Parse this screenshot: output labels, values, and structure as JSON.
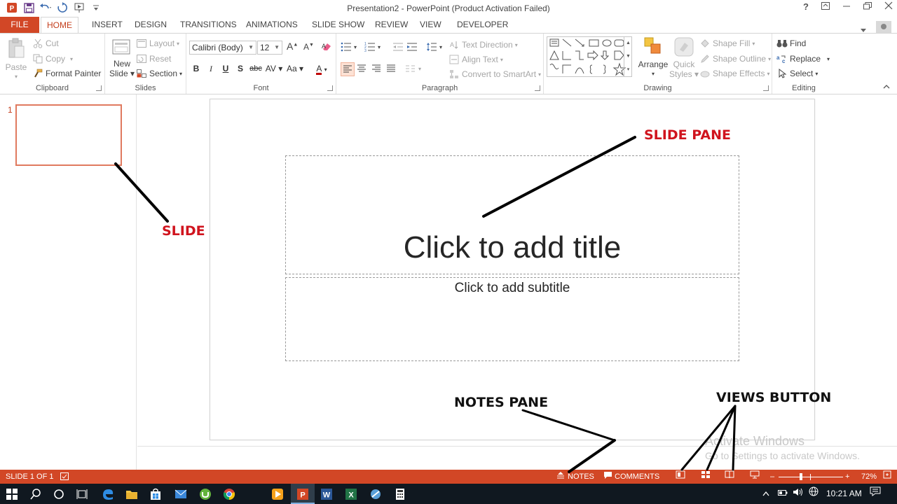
{
  "window": {
    "title": "Presentation2 - PowerPoint (Product Activation Failed)",
    "help": "?"
  },
  "tabs": [
    "FILE",
    "HOME",
    "INSERT",
    "DESIGN",
    "TRANSITIONS",
    "ANIMATIONS",
    "SLIDE SHOW",
    "REVIEW",
    "VIEW",
    "DEVELOPER"
  ],
  "ribbon": {
    "clipboard": {
      "label": "Clipboard",
      "paste": "Paste",
      "cut": "Cut",
      "copy": "Copy",
      "format_painter": "Format Painter"
    },
    "slides": {
      "label": "Slides",
      "new_slide_1": "New",
      "new_slide_2": "Slide",
      "layout": "Layout",
      "reset": "Reset",
      "section": "Section"
    },
    "font": {
      "label": "Font",
      "family": "Calibri (Body)",
      "size": "12"
    },
    "paragraph": {
      "label": "Paragraph",
      "text_direction": "Text Direction",
      "align_text": "Align Text",
      "convert_smartart": "Convert to SmartArt"
    },
    "drawing": {
      "label": "Drawing",
      "arrange": "Arrange",
      "quick_styles_1": "Quick",
      "quick_styles_2": "Styles",
      "shape_fill": "Shape Fill",
      "shape_outline": "Shape Outline",
      "shape_effects": "Shape Effects"
    },
    "editing": {
      "label": "Editing",
      "find": "Find",
      "replace": "Replace",
      "select": "Select"
    }
  },
  "thumbnails": {
    "slide_number": "1"
  },
  "slide": {
    "title_placeholder": "Click to add title",
    "subtitle_placeholder": "Click to add subtitle"
  },
  "annotations": {
    "slide_pane": "SLIDE PANE",
    "slide": "SLIDE",
    "notes_pane": "NOTES PANE",
    "views_button": "VIEWS BUTTON"
  },
  "watermark": {
    "line1": "Activate Windows",
    "line2": "Go to Settings to activate Windows."
  },
  "status": {
    "slide_info": "SLIDE 1 OF 1",
    "notes": "NOTES",
    "comments": "COMMENTS",
    "zoom": "72%"
  },
  "taskbar": {
    "time": "10:21 AM"
  },
  "colors": {
    "accent": "#d24726",
    "annotation_red": "#d0141e"
  }
}
